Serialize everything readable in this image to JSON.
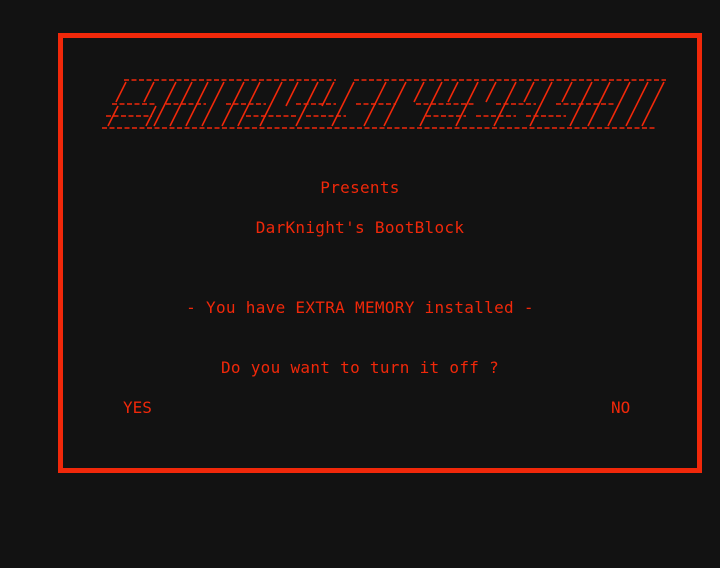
{
  "colors": {
    "background": "#121212",
    "accent": "#f0280a"
  },
  "intro": {
    "presents": "Presents",
    "title": "DarKnight's BootBlock"
  },
  "message": {
    "warning": "- You have EXTRA MEMORY installed -",
    "question": "Do you want to turn it off ?"
  },
  "choices": {
    "yes": "YES",
    "no": "NO"
  }
}
